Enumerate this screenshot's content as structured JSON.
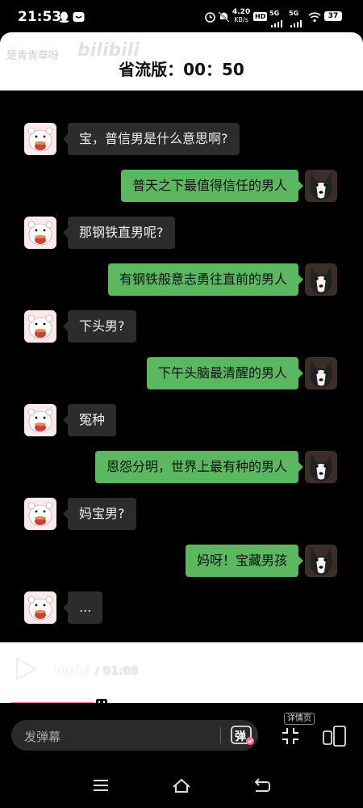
{
  "status_bar": {
    "time": "21:53",
    "net_speed_value": "4.20",
    "net_speed_unit": "KB/s",
    "hd_label": "HD",
    "signal1_label": "5G",
    "signal2_label": "5G",
    "battery": "37"
  },
  "header": {
    "watermark_text": "是青青草呀",
    "watermark_logo": "bilibili",
    "countdown": "省流版：00：50"
  },
  "chat": {
    "messages": [
      {
        "side": "left",
        "text": "宝，普信男是什么意思啊?"
      },
      {
        "side": "right",
        "text": "普天之下最值得信任的男人"
      },
      {
        "side": "left",
        "text": "那钢铁直男呢?"
      },
      {
        "side": "right",
        "text": "有钢铁般意志勇往直前的男人"
      },
      {
        "side": "left",
        "text": "下头男?"
      },
      {
        "side": "right",
        "text": "下午头脑最清醒的男人"
      },
      {
        "side": "left",
        "text": "冤种"
      },
      {
        "side": "right",
        "text": "恩怨分明，世界上最有种的男人"
      },
      {
        "side": "left",
        "text": "妈宝男?"
      },
      {
        "side": "right",
        "text": "妈呀！宝藏男孩"
      },
      {
        "side": "left",
        "text": "..."
      }
    ]
  },
  "player": {
    "current_time": "00:18",
    "separator": " / ",
    "total_time": "01:08",
    "progress": 0.265,
    "accent_color": "#fb7299"
  },
  "bottom_bar": {
    "danmaku_placeholder": "发弹幕",
    "danmaku_button_label": "弹",
    "details_label": "详情页"
  },
  "icons": {
    "play": "play-icon",
    "fullscreen": "fullscreen-icon",
    "split_screen": "split-screen-icon",
    "menu": "menu-icon",
    "home": "home-icon",
    "back": "back-icon"
  }
}
